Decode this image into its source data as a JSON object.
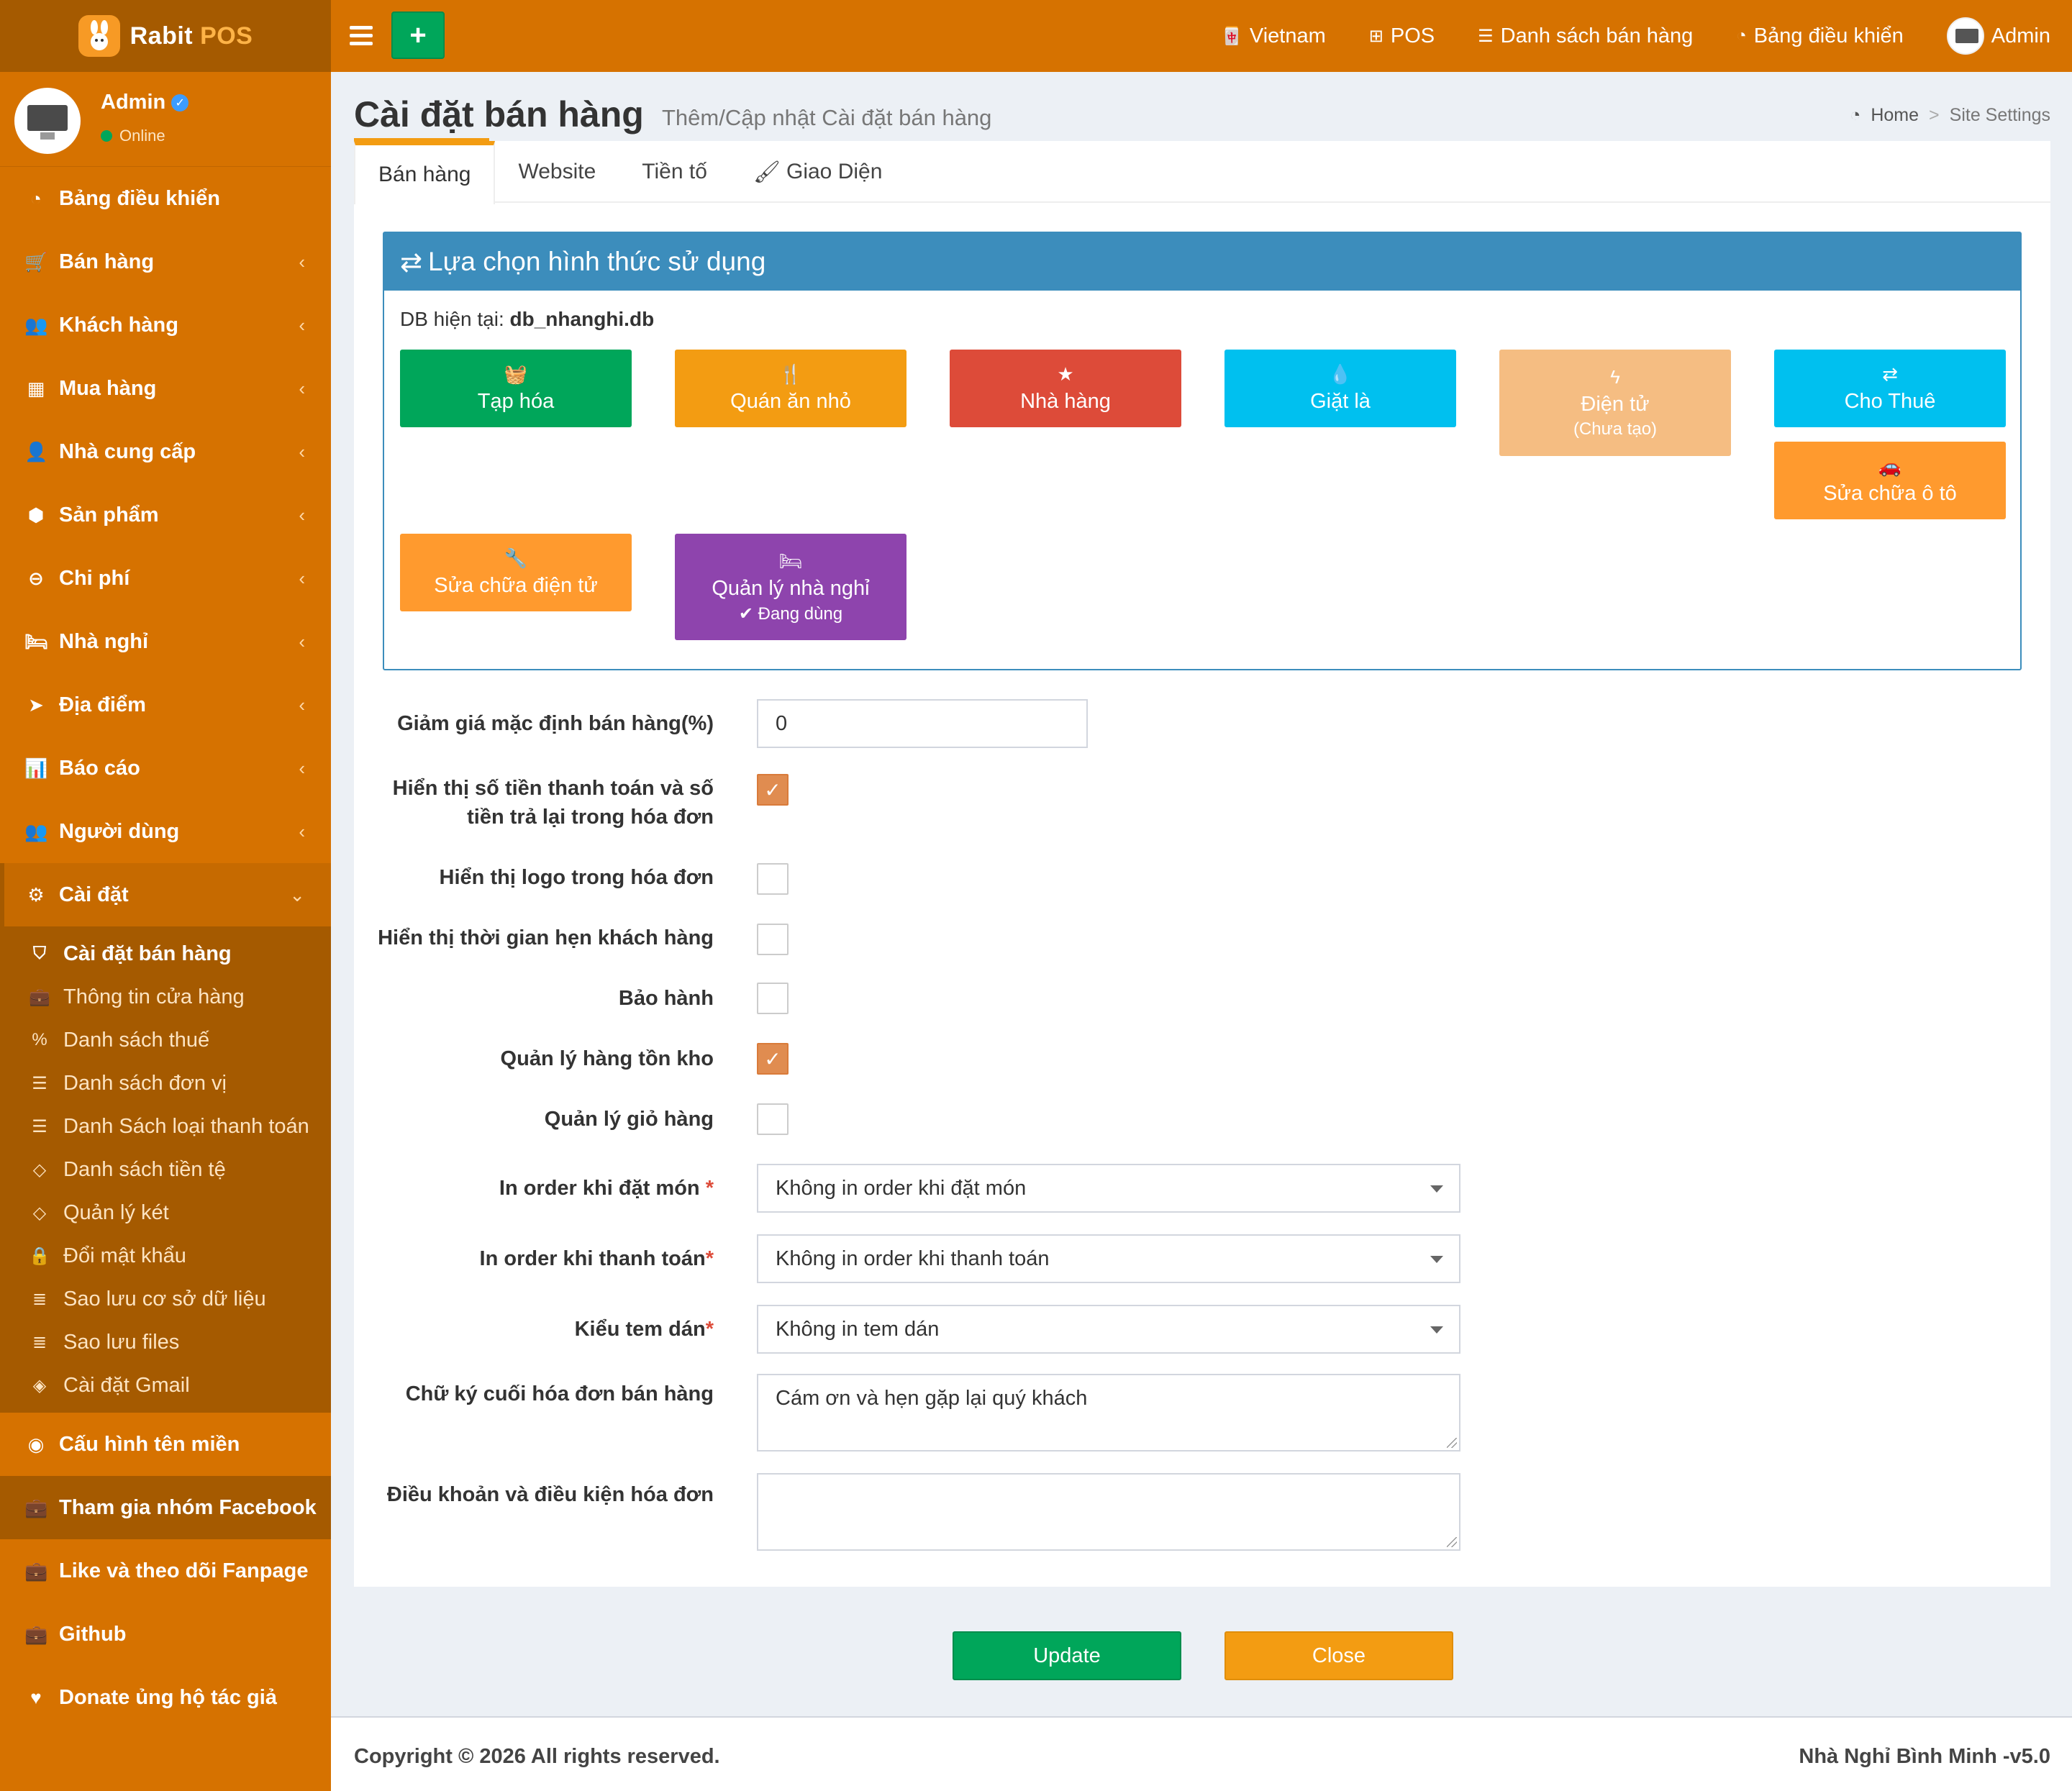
{
  "brand": {
    "name": "Rabit",
    "suffix": "POS"
  },
  "topnav": {
    "language": "Vietnam",
    "pos": "POS",
    "sales_list": "Danh sách bán hàng",
    "dashboard": "Bảng điều khiển",
    "user": "Admin"
  },
  "user_panel": {
    "name": "Admin",
    "status": "Online"
  },
  "sidebar": {
    "items": [
      {
        "label": "Bảng điều khiển",
        "icon": "dashboard-icon"
      },
      {
        "label": "Bán hàng",
        "icon": "cart-icon"
      },
      {
        "label": "Khách hàng",
        "icon": "users-icon"
      },
      {
        "label": "Mua hàng",
        "icon": "grid-icon"
      },
      {
        "label": "Nhà cung cấp",
        "icon": "user-plus-icon"
      },
      {
        "label": "Sản phẩm",
        "icon": "cubes-icon"
      },
      {
        "label": "Chi phí",
        "icon": "minus-circle-icon"
      },
      {
        "label": "Nhà nghỉ",
        "icon": "bed-icon"
      },
      {
        "label": "Địa điểm",
        "icon": "send-icon"
      },
      {
        "label": "Báo cáo",
        "icon": "bar-chart-icon"
      },
      {
        "label": "Người dùng",
        "icon": "users-icon"
      },
      {
        "label": "Cài đặt",
        "icon": "gears-icon"
      }
    ],
    "settings_sub": [
      "Cài đặt bán hàng",
      "Thông tin cửa hàng",
      "Danh sách thuế",
      "Danh sách đơn vị",
      "Danh Sách loại thanh toán",
      "Danh sách tiền tệ",
      "Quản lý két",
      "Đổi mật khẩu",
      "Sao lưu cơ sở dữ liệu",
      "Sao lưu files",
      "Cài đặt Gmail"
    ],
    "extra": [
      "Cấu hình tên miền",
      "Tham gia nhóm Facebook",
      "Like và theo dõi Fanpage",
      "Github",
      "Donate ủng hộ tác giả"
    ]
  },
  "page": {
    "title": "Cài đặt bán hàng",
    "subtitle": "Thêm/Cập nhật Cài đặt bán hàng",
    "breadcrumb_home": "Home",
    "breadcrumb_sep": ">",
    "breadcrumb_current": "Site Settings"
  },
  "tabs": [
    "Bán hàng",
    "Website",
    "Tiền tố",
    "Giao Diện"
  ],
  "panel": {
    "title": "Lựa chọn hình thức sử dụng",
    "db_label": "DB hiện tại:",
    "db_value": "db_nhanghi.db",
    "modes": [
      {
        "label": "Tạp hóa",
        "color": "#00a65a"
      },
      {
        "label": "Quán ăn nhỏ",
        "color": "#f39c12"
      },
      {
        "label": "Nhà hàng",
        "color": "#dd4b39"
      },
      {
        "label": "Giặt là",
        "color": "#00c0ef"
      },
      {
        "label": "Điện tử",
        "sub": "(Chưa tạo)",
        "color": "#f5bd82"
      },
      {
        "label": "Cho Thuê",
        "color": "#00c0ef"
      },
      {
        "label": "Sửa chữa ô tô",
        "color": "#ff9a2e"
      },
      {
        "label": "Sửa chữa điện tử",
        "color": "#ff9a2e"
      },
      {
        "label": "Quản lý nhà nghỉ",
        "sub": "Đang dùng",
        "color": "#8e44ad"
      }
    ]
  },
  "form": {
    "discount_label": "Giảm giá mặc định bán hàng(%)",
    "discount_value": "0",
    "show_payment_line1": "Hiển thị số tiền thanh toán và số",
    "show_payment_line2": "tiền trả lại trong hóa đơn",
    "show_logo": "Hiển thị logo trong hóa đơn",
    "show_appointment": "Hiển thị thời gian hẹn khách hàng",
    "warranty": "Bảo hành",
    "inventory": "Quản lý hàng tồn kho",
    "cart": "Quản lý giỏ hàng",
    "print_order_label": "In order khi đặt món",
    "print_order_value": "Không in order khi đặt món",
    "print_payment_label": "In order khi thanh toán",
    "print_payment_value": "Không in order khi thanh toán",
    "sticker_label": "Kiểu tem dán",
    "sticker_value": "Không in tem dán",
    "signature_label": "Chữ ký cuối hóa đơn bán hàng",
    "signature_value": "Cám ơn và hẹn gặp lại quý khách",
    "terms_label": "Điều khoản và điều kiện hóa đơn",
    "terms_value": "",
    "required_mark": "*",
    "checks": {
      "show_payment": true,
      "show_logo": false,
      "show_appointment": false,
      "warranty": false,
      "inventory": true,
      "cart": false
    }
  },
  "buttons": {
    "update": "Update",
    "close": "Close",
    "update_color": "#00a65a",
    "close_color": "#f39c12"
  },
  "footer": {
    "copyright": "Copyright © 2026 All rights reserved.",
    "app": "Nhà Nghỉ Bình Minh -v5.0"
  }
}
